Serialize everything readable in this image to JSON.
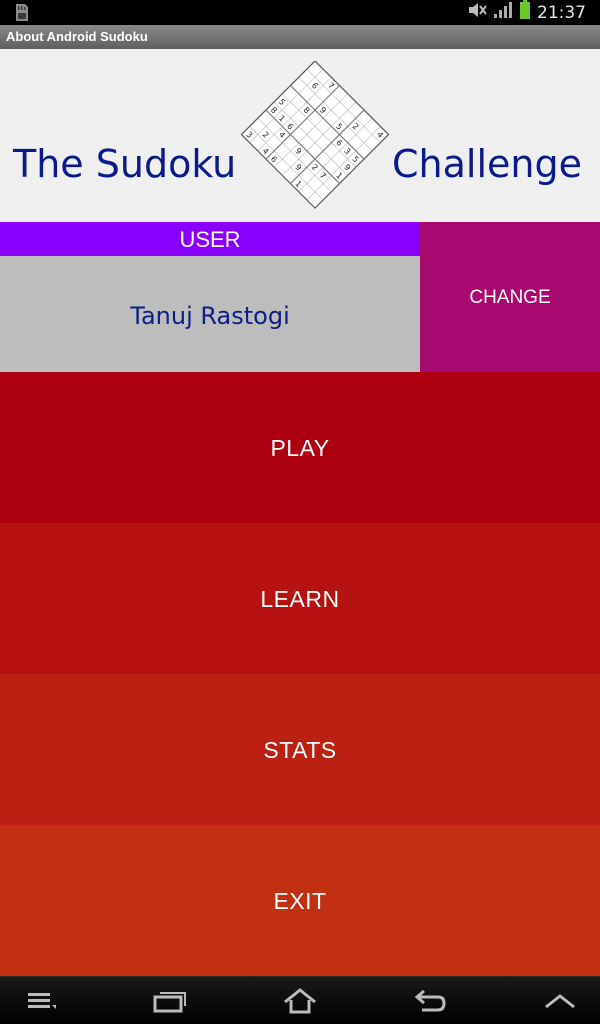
{
  "status_bar": {
    "time": "21:37",
    "left_icon": "sd-card-icon",
    "right_icons": [
      "mute-icon",
      "signal-icon",
      "battery-icon"
    ]
  },
  "title_bar": {
    "title": "About Android Sudoku"
  },
  "header": {
    "title_left": "The Sudoku",
    "title_right": "Challenge",
    "logo": "sudoku-grid-icon",
    "logo_digits": [
      [
        "",
        "",
        "7",
        "",
        "",
        "",
        "",
        "",
        "4"
      ],
      [
        "",
        "6",
        "",
        "",
        "",
        "",
        "2",
        "",
        ""
      ],
      [
        "",
        "",
        "",
        "9",
        "",
        "5",
        "",
        "",
        ""
      ],
      [
        "",
        "",
        "8",
        "",
        "",
        "",
        "6",
        "3",
        "5"
      ],
      [
        "5",
        "",
        "",
        "",
        "",
        "",
        "",
        "",
        "9"
      ],
      [
        "8",
        "1",
        "6",
        "",
        "",
        "",
        "",
        "",
        "1"
      ],
      [
        "",
        "",
        "4",
        "",
        "9",
        "",
        "2",
        "7",
        ""
      ],
      [
        "",
        "2",
        "",
        "",
        "",
        "9",
        "",
        "",
        ""
      ],
      [
        "3",
        "",
        "4",
        "6",
        "",
        "",
        "1",
        "",
        ""
      ]
    ]
  },
  "user": {
    "label": "USER",
    "name": "Tanuj Rastogi",
    "change_label": "CHANGE"
  },
  "menu": {
    "play": "PLAY",
    "learn": "LEARN",
    "stats": "STATS",
    "exit": "EXIT"
  },
  "colors": {
    "title_text": "#0a1a8a",
    "user_label_bg": "#8a00ff",
    "user_name_bg": "#bdbdbd",
    "change_bg": "#a8096e",
    "play_bg": "#ae0010",
    "learn_bg": "#b61210",
    "stats_bg": "#bb2010",
    "exit_bg": "#c13010"
  },
  "nav_bar": {
    "buttons": [
      "menu-icon",
      "recent-apps-icon",
      "home-icon",
      "back-icon",
      "hide-keyboard-icon"
    ]
  }
}
